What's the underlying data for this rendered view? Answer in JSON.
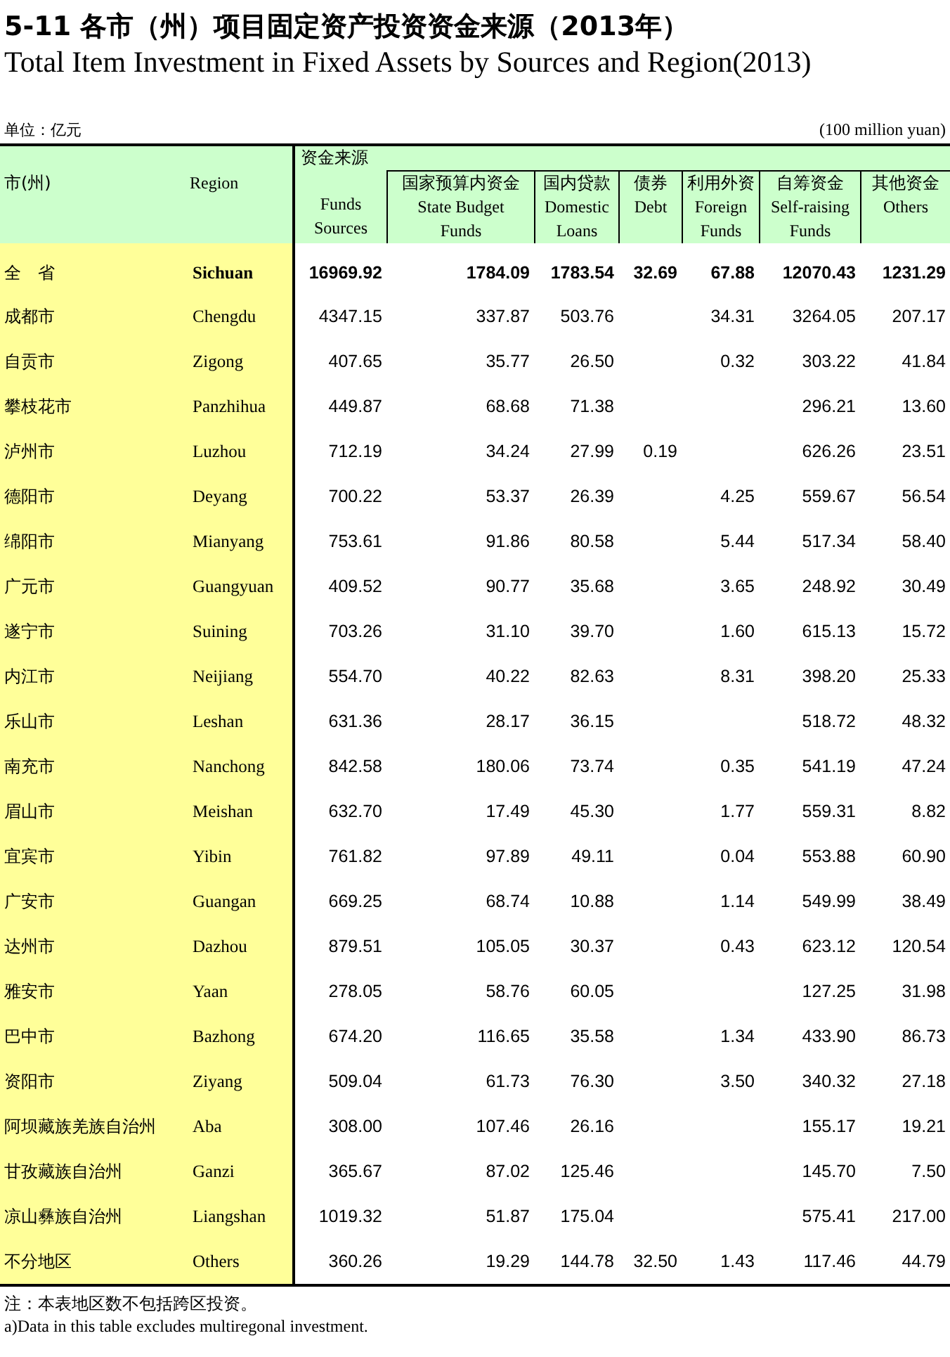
{
  "title": {
    "zh": "5-11  各市（州）项目固定资产投资资金来源（2013年）",
    "en": "Total Item Investment in Fixed Assets by Sources and Region(2013)"
  },
  "unit": {
    "zh": "单位：亿元",
    "en": "(100 million yuan)"
  },
  "table": {
    "group_header": "资金来源",
    "columns": [
      {
        "zh": "市(州)"
      },
      {
        "en": [
          "Region"
        ]
      },
      {
        "en": [
          "Funds",
          "Sources"
        ]
      },
      {
        "zh": "国家预算内资金",
        "en": [
          "State Budget",
          "Funds"
        ]
      },
      {
        "zh": "国内贷款",
        "en": [
          "Domestic",
          "Loans"
        ]
      },
      {
        "zh": "债券",
        "en": [
          "Debt"
        ]
      },
      {
        "zh": "利用外资",
        "en": [
          "Foreign",
          "Funds"
        ]
      },
      {
        "zh": "自筹资金",
        "en": [
          "Self-raising",
          "Funds"
        ]
      },
      {
        "zh": "其他资金",
        "en": [
          "Others"
        ]
      }
    ],
    "rows": [
      {
        "kind": "total",
        "cells": [
          "全　省",
          "Sichuan",
          "16969.92",
          "1784.09",
          "1783.54",
          "32.69",
          "67.88",
          "12070.43",
          "1231.29"
        ]
      },
      {
        "kind": "city",
        "cells": [
          "成都市",
          "Chengdu",
          "4347.15",
          "337.87",
          "503.76",
          null,
          "34.31",
          "3264.05",
          "207.17"
        ]
      },
      {
        "kind": "city",
        "cells": [
          "自贡市",
          "Zigong",
          "407.65",
          "35.77",
          "26.50",
          null,
          "0.32",
          "303.22",
          "41.84"
        ]
      },
      {
        "kind": "city",
        "cells": [
          "攀枝花市",
          "Panzhihua",
          "449.87",
          "68.68",
          "71.38",
          null,
          null,
          "296.21",
          "13.60"
        ]
      },
      {
        "kind": "city",
        "cells": [
          "泸州市",
          "Luzhou",
          "712.19",
          "34.24",
          "27.99",
          "0.19",
          null,
          "626.26",
          "23.51"
        ]
      },
      {
        "kind": "city",
        "cells": [
          "德阳市",
          "Deyang",
          "700.22",
          "53.37",
          "26.39",
          null,
          "4.25",
          "559.67",
          "56.54"
        ]
      },
      {
        "kind": "city",
        "cells": [
          "绵阳市",
          "Mianyang",
          "753.61",
          "91.86",
          "80.58",
          null,
          "5.44",
          "517.34",
          "58.40"
        ]
      },
      {
        "kind": "city",
        "cells": [
          "广元市",
          "Guangyuan",
          "409.52",
          "90.77",
          "35.68",
          null,
          "3.65",
          "248.92",
          "30.49"
        ]
      },
      {
        "kind": "city",
        "cells": [
          "遂宁市",
          "Suining",
          "703.26",
          "31.10",
          "39.70",
          null,
          "1.60",
          "615.13",
          "15.72"
        ]
      },
      {
        "kind": "city",
        "cells": [
          "内江市",
          "Neijiang",
          "554.70",
          "40.22",
          "82.63",
          null,
          "8.31",
          "398.20",
          "25.33"
        ]
      },
      {
        "kind": "city",
        "cells": [
          "乐山市",
          "Leshan",
          "631.36",
          "28.17",
          "36.15",
          null,
          null,
          "518.72",
          "48.32"
        ]
      },
      {
        "kind": "city",
        "cells": [
          "南充市",
          "Nanchong",
          "842.58",
          "180.06",
          "73.74",
          null,
          "0.35",
          "541.19",
          "47.24"
        ]
      },
      {
        "kind": "city",
        "cells": [
          "眉山市",
          "Meishan",
          "632.70",
          "17.49",
          "45.30",
          null,
          "1.77",
          "559.31",
          "8.82"
        ]
      },
      {
        "kind": "city",
        "cells": [
          "宜宾市",
          "Yibin",
          "761.82",
          "97.89",
          "49.11",
          null,
          "0.04",
          "553.88",
          "60.90"
        ]
      },
      {
        "kind": "city",
        "cells": [
          "广安市",
          "Guangan",
          "669.25",
          "68.74",
          "10.88",
          null,
          "1.14",
          "549.99",
          "38.49"
        ]
      },
      {
        "kind": "city",
        "cells": [
          "达州市",
          "Dazhou",
          "879.51",
          "105.05",
          "30.37",
          null,
          "0.43",
          "623.12",
          "120.54"
        ]
      },
      {
        "kind": "city",
        "cells": [
          "雅安市",
          "Yaan",
          "278.05",
          "58.76",
          "60.05",
          null,
          null,
          "127.25",
          "31.98"
        ]
      },
      {
        "kind": "city",
        "cells": [
          "巴中市",
          "Bazhong",
          "674.20",
          "116.65",
          "35.58",
          null,
          "1.34",
          "433.90",
          "86.73"
        ]
      },
      {
        "kind": "city",
        "cells": [
          "资阳市",
          "Ziyang",
          "509.04",
          "61.73",
          "76.30",
          null,
          "3.50",
          "340.32",
          "27.18"
        ]
      },
      {
        "kind": "city",
        "cells": [
          "阿坝藏族羌族自治州",
          "Aba",
          "308.00",
          "107.46",
          "26.16",
          null,
          null,
          "155.17",
          "19.21"
        ]
      },
      {
        "kind": "city",
        "cells": [
          "甘孜藏族自治州",
          "Ganzi",
          "365.67",
          "87.02",
          "125.46",
          null,
          null,
          "145.70",
          "7.50"
        ]
      },
      {
        "kind": "city",
        "cells": [
          "凉山彝族自治州",
          "Liangshan",
          "1019.32",
          "51.87",
          "175.04",
          null,
          null,
          "575.41",
          "217.00"
        ]
      },
      {
        "kind": "city",
        "cells": [
          "不分地区",
          "Others",
          "360.26",
          "19.29",
          "144.78",
          "32.50",
          "1.43",
          "117.46",
          "44.79"
        ]
      }
    ]
  },
  "notes": [
    "注：本表地区数不包括跨区投资。",
    "a)Data in this table excludes multiregonal investment."
  ]
}
